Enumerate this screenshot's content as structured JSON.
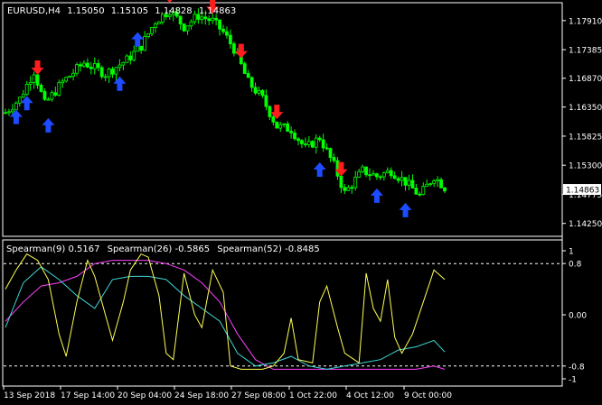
{
  "header": {
    "symbol": "EURUSD,H4",
    "open": "1.15050",
    "high": "1.15105",
    "low": "1.14828",
    "close": "1.14863"
  },
  "colors": {
    "background": "#000000",
    "bull_candle": "#00ff00",
    "bear_candle": "#00ff00",
    "up_arrow": "#1e4bff",
    "down_arrow": "#ff1e1e",
    "spearman9": "#ffff55",
    "spearman26": "#40d8d8",
    "spearman52": "#ff40ff",
    "axis": "#ffffff",
    "level_line": "#ffffff"
  },
  "price_axis": {
    "ticks": [
      "1.17910",
      "1.17385",
      "1.16870",
      "1.16350",
      "1.15825",
      "1.15300",
      "1.14775",
      "1.14250"
    ],
    "current_price": "1.14863",
    "range": [
      1.1405,
      1.182
    ]
  },
  "indicator": {
    "label_parts": [
      "Spearman(9) 0.5167",
      "Spearman(26) -0.5865",
      "Spearman(52) -0.8485"
    ],
    "axis_ticks": [
      "1",
      "0.8",
      "0.00",
      "-0.8",
      "-1"
    ],
    "levels": [
      0.8,
      -0.8
    ],
    "range": [
      -1,
      1
    ]
  },
  "time_axis": {
    "labels": [
      "13 Sep 2018",
      "17 Sep 14:00",
      "20 Sep 04:00",
      "24 Sep 18:00",
      "27 Sep 08:00",
      "1 Oct 22:00",
      "4 Oct 12:00",
      "9 Oct 00:00"
    ]
  },
  "chart_data": {
    "type": "candlestick",
    "series_anchor_close": [
      [
        0,
        1.1625
      ],
      [
        4,
        1.165
      ],
      [
        8,
        1.17
      ],
      [
        11,
        1.164
      ],
      [
        16,
        1.168
      ],
      [
        22,
        1.1715
      ],
      [
        28,
        1.1695
      ],
      [
        34,
        1.172
      ],
      [
        38,
        1.1745
      ],
      [
        42,
        1.179
      ],
      [
        46,
        1.181
      ],
      [
        50,
        1.178
      ],
      [
        54,
        1.18
      ],
      [
        58,
        1.179
      ],
      [
        61,
        1.177
      ],
      [
        64,
        1.174
      ],
      [
        68,
        1.168
      ],
      [
        72,
        1.165
      ],
      [
        76,
        1.16
      ],
      [
        80,
        1.1595
      ],
      [
        84,
        1.156
      ],
      [
        88,
        1.158
      ],
      [
        92,
        1.153
      ],
      [
        95,
        1.148
      ],
      [
        100,
        1.152
      ],
      [
        104,
        1.151
      ],
      [
        108,
        1.152
      ],
      [
        112,
        1.15
      ],
      [
        116,
        1.1475
      ],
      [
        120,
        1.151
      ],
      [
        123,
        1.149
      ]
    ],
    "up_arrows_at": [
      2,
      4,
      12,
      32,
      38
    ],
    "down_arrows_at": [
      9,
      46,
      58,
      70,
      94
    ],
    "up_arrow_prices": [
      1.164,
      1.1665,
      1.1625,
      1.17,
      1.178,
      1.1545,
      1.1498,
      1.1472
    ],
    "spearman9_points": [
      [
        0,
        0.4
      ],
      [
        3,
        0.7
      ],
      [
        6,
        0.95
      ],
      [
        9,
        0.85
      ],
      [
        12,
        0.55
      ],
      [
        15,
        -0.3
      ],
      [
        17,
        -0.65
      ],
      [
        20,
        0.2
      ],
      [
        23,
        0.85
      ],
      [
        25,
        0.6
      ],
      [
        28,
        0.0
      ],
      [
        30,
        -0.4
      ],
      [
        33,
        0.2
      ],
      [
        35,
        0.7
      ],
      [
        38,
        0.95
      ],
      [
        40,
        0.9
      ],
      [
        43,
        0.3
      ],
      [
        45,
        -0.6
      ],
      [
        47,
        -0.7
      ],
      [
        50,
        0.65
      ],
      [
        53,
        0.0
      ],
      [
        55,
        -0.2
      ],
      [
        58,
        0.7
      ],
      [
        61,
        0.35
      ],
      [
        63,
        -0.8
      ],
      [
        66,
        -0.85
      ],
      [
        69,
        -0.85
      ],
      [
        72,
        -0.85
      ],
      [
        75,
        -0.8
      ],
      [
        78,
        -0.6
      ],
      [
        80,
        -0.05
      ],
      [
        82,
        -0.7
      ],
      [
        86,
        -0.75
      ],
      [
        88,
        0.2
      ],
      [
        90,
        0.45
      ],
      [
        93,
        -0.2
      ],
      [
        95,
        -0.6
      ],
      [
        99,
        -0.75
      ],
      [
        101,
        0.65
      ],
      [
        103,
        0.1
      ],
      [
        105,
        -0.1
      ],
      [
        107,
        0.55
      ],
      [
        109,
        -0.35
      ],
      [
        111,
        -0.6
      ],
      [
        114,
        -0.3
      ],
      [
        117,
        0.2
      ],
      [
        120,
        0.7
      ],
      [
        123,
        0.55
      ]
    ],
    "spearman26_points": [
      [
        0,
        -0.2
      ],
      [
        5,
        0.5
      ],
      [
        10,
        0.75
      ],
      [
        15,
        0.55
      ],
      [
        20,
        0.3
      ],
      [
        25,
        0.1
      ],
      [
        30,
        0.55
      ],
      [
        35,
        0.6
      ],
      [
        40,
        0.6
      ],
      [
        45,
        0.55
      ],
      [
        50,
        0.3
      ],
      [
        55,
        0.1
      ],
      [
        60,
        -0.1
      ],
      [
        65,
        -0.6
      ],
      [
        70,
        -0.8
      ],
      [
        75,
        -0.75
      ],
      [
        80,
        -0.65
      ],
      [
        85,
        -0.8
      ],
      [
        90,
        -0.85
      ],
      [
        95,
        -0.8
      ],
      [
        100,
        -0.75
      ],
      [
        105,
        -0.7
      ],
      [
        110,
        -0.55
      ],
      [
        115,
        -0.5
      ],
      [
        120,
        -0.4
      ],
      [
        123,
        -0.58
      ]
    ],
    "spearman52_points": [
      [
        0,
        -0.1
      ],
      [
        5,
        0.2
      ],
      [
        10,
        0.45
      ],
      [
        15,
        0.5
      ],
      [
        20,
        0.6
      ],
      [
        25,
        0.8
      ],
      [
        30,
        0.85
      ],
      [
        35,
        0.85
      ],
      [
        40,
        0.85
      ],
      [
        45,
        0.8
      ],
      [
        50,
        0.7
      ],
      [
        55,
        0.5
      ],
      [
        60,
        0.2
      ],
      [
        65,
        -0.3
      ],
      [
        70,
        -0.7
      ],
      [
        75,
        -0.85
      ],
      [
        80,
        -0.85
      ],
      [
        85,
        -0.85
      ],
      [
        90,
        -0.85
      ],
      [
        95,
        -0.85
      ],
      [
        100,
        -0.85
      ],
      [
        105,
        -0.85
      ],
      [
        110,
        -0.85
      ],
      [
        115,
        -0.85
      ],
      [
        120,
        -0.8
      ],
      [
        123,
        -0.85
      ]
    ],
    "bars_count": 124
  }
}
